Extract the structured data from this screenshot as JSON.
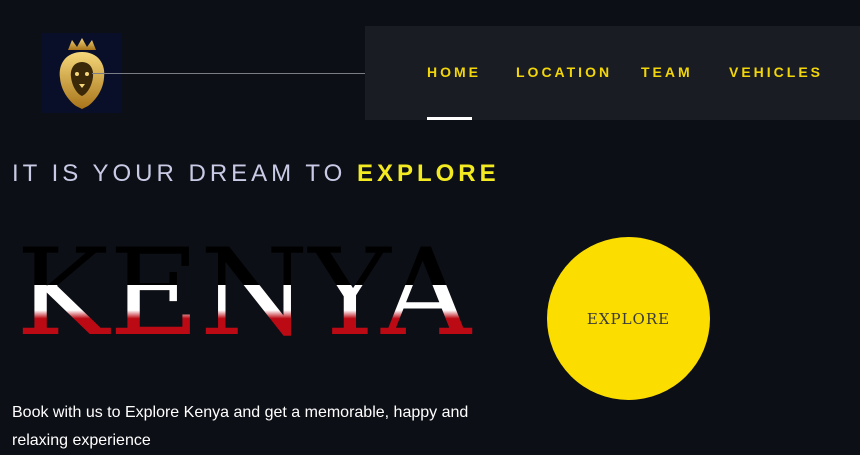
{
  "header": {
    "nav": [
      {
        "label": "HOME",
        "active": true
      },
      {
        "label": "LOCATION"
      },
      {
        "label": "TEAM"
      },
      {
        "label": "VEHICLES"
      }
    ]
  },
  "hero": {
    "tagline_prefix": "IT IS YOUR DREAM TO",
    "tagline_highlight": "EXPLORE",
    "big_word": "KENYA",
    "explore_button": "EXPLORE",
    "description": "Book with us to Explore Kenya and get a memorable, happy and relaxing experience"
  },
  "colors": {
    "background": "#0d0f16",
    "nav_background": "#1a1c23",
    "accent_yellow": "#fcdd00",
    "flag_black": "#000000",
    "flag_white": "#ffffff",
    "flag_red": "#bb0a14"
  }
}
